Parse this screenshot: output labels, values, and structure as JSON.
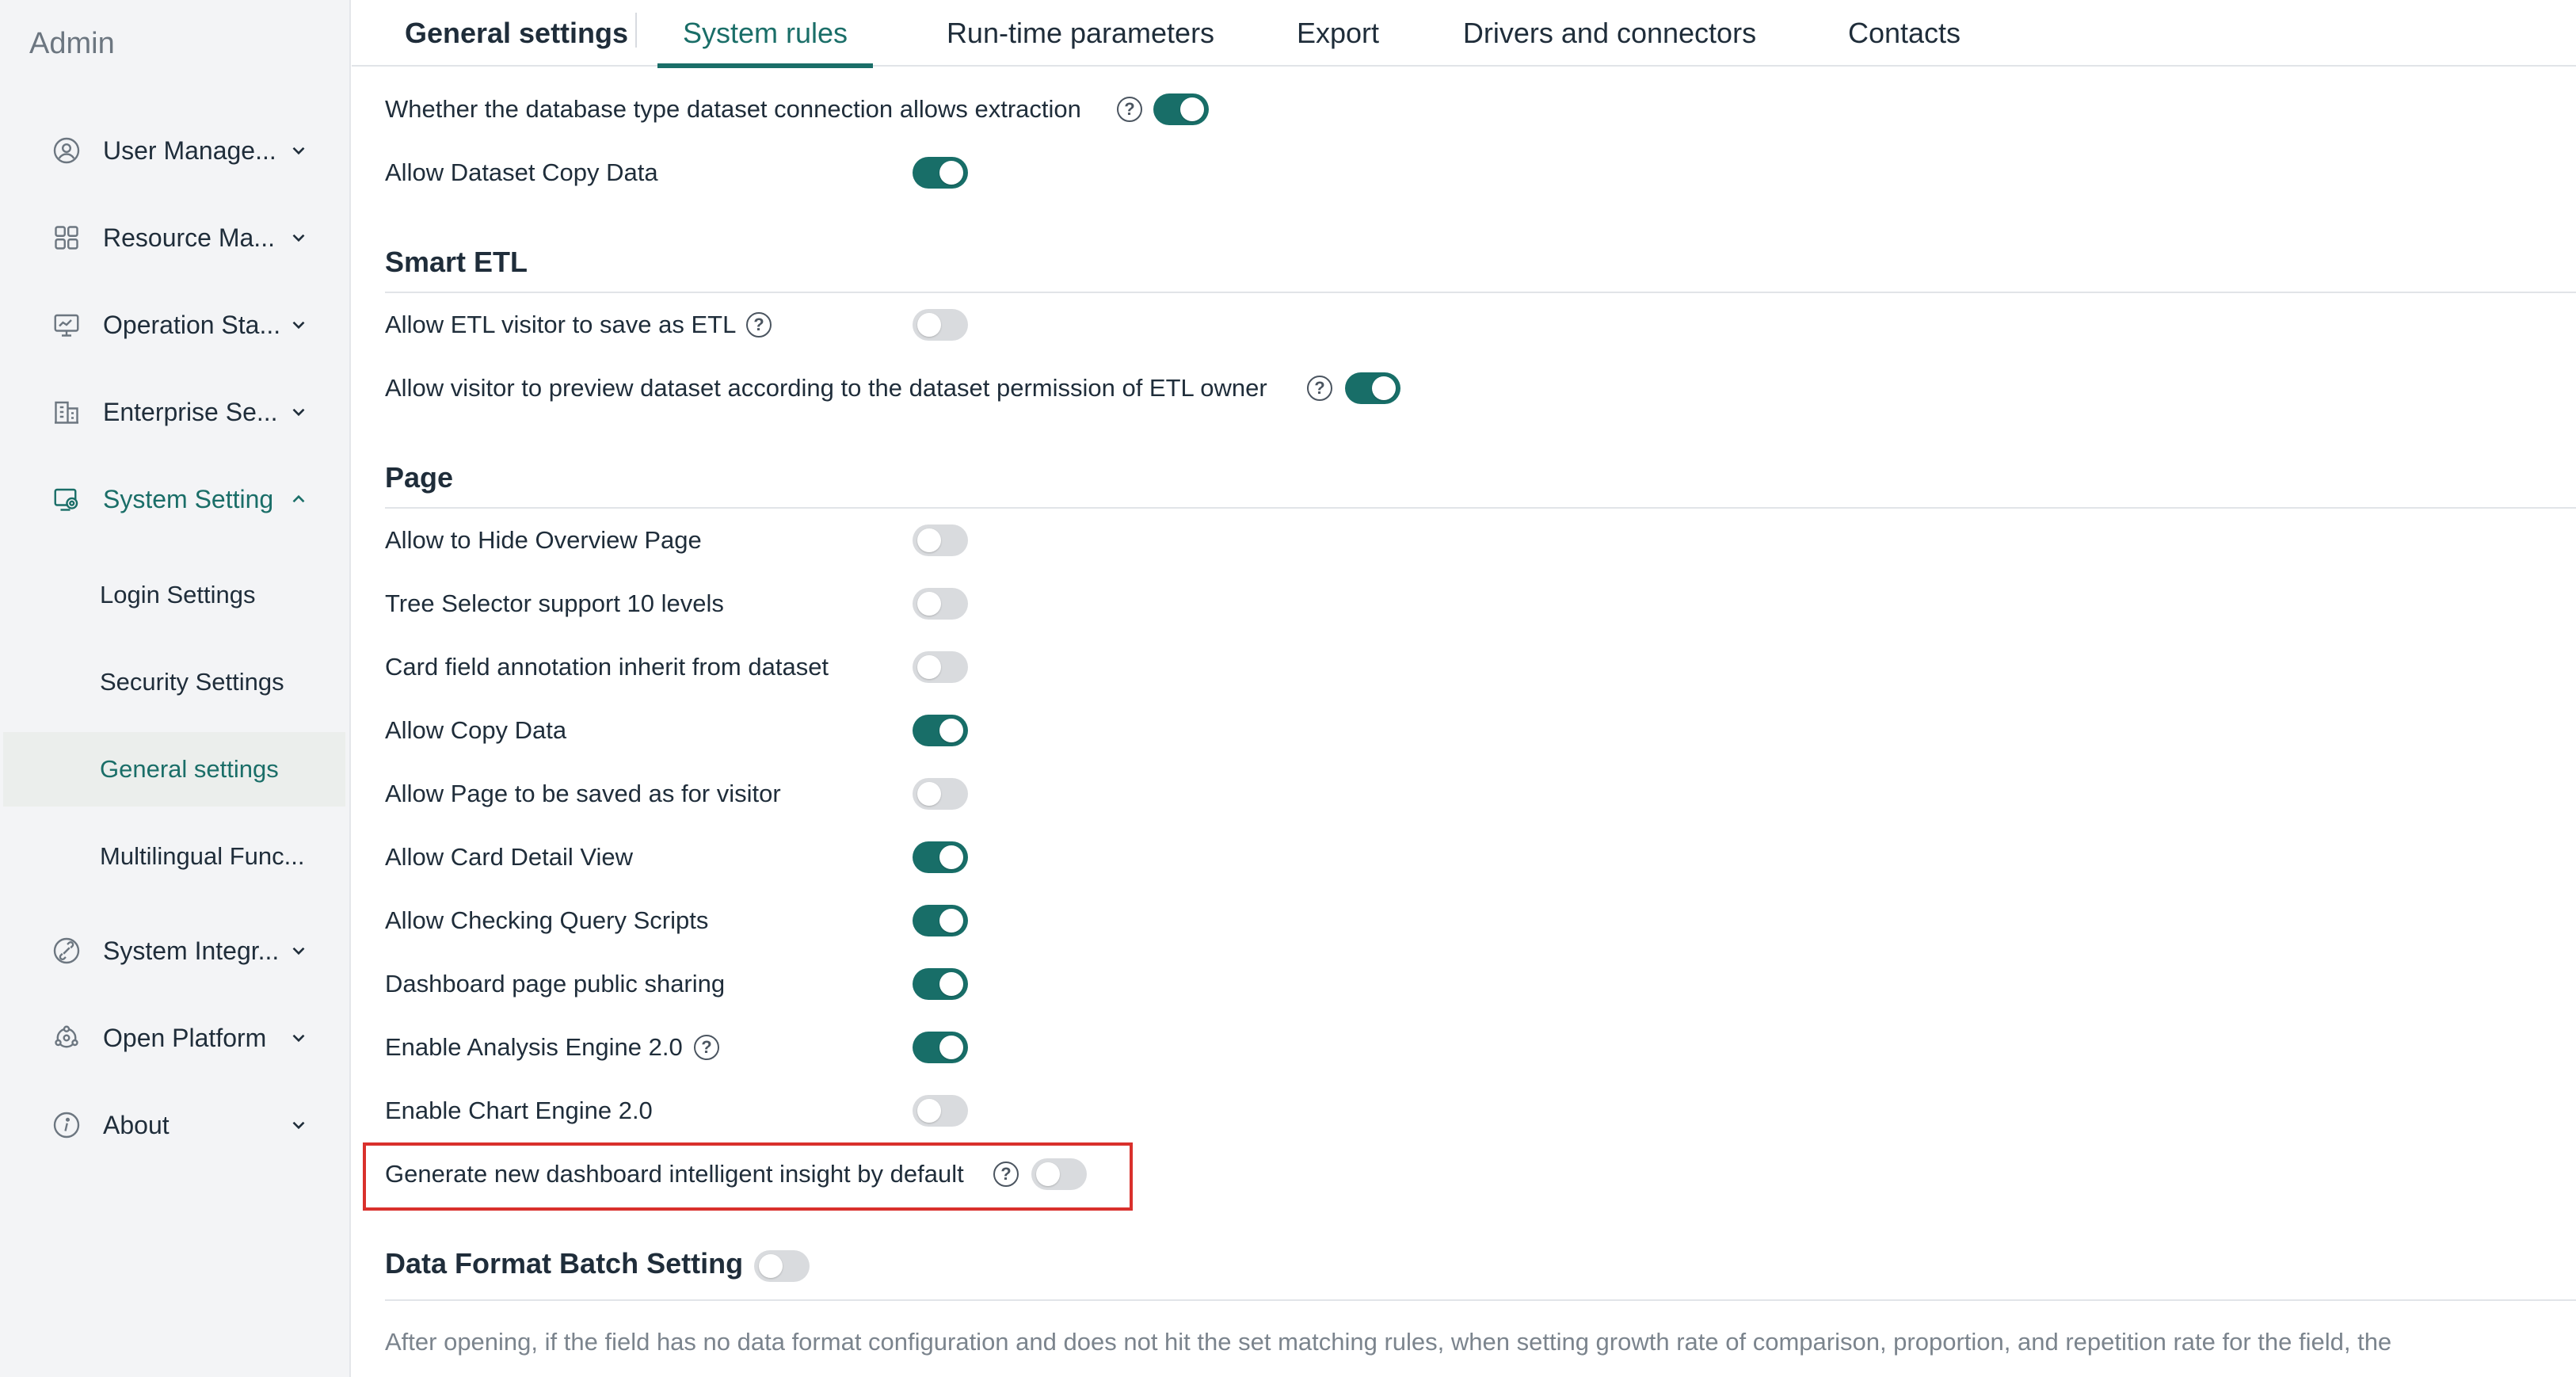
{
  "sidebar": {
    "brand": "Admin",
    "items": [
      {
        "label": "User Manage...",
        "icon": "user-icon"
      },
      {
        "label": "Resource Ma...",
        "icon": "grid-icon"
      },
      {
        "label": "Operation Sta...",
        "icon": "monitor-icon"
      },
      {
        "label": "Enterprise Se...",
        "icon": "building-icon"
      },
      {
        "label": "System Setting",
        "icon": "system-setting-icon",
        "expanded": true
      },
      {
        "label": "System Integr...",
        "icon": "integration-icon"
      },
      {
        "label": "Open Platform",
        "icon": "platform-icon"
      },
      {
        "label": "About",
        "icon": "info-icon"
      }
    ],
    "sub_items": [
      {
        "label": "Login Settings"
      },
      {
        "label": "Security Settings"
      },
      {
        "label": "General settings",
        "selected": true
      },
      {
        "label": "Multilingual Func..."
      }
    ]
  },
  "tabs": [
    {
      "label": "General settings"
    },
    {
      "label": "System rules",
      "active": true
    },
    {
      "label": "Run-time parameters"
    },
    {
      "label": "Export"
    },
    {
      "label": "Drivers and connectors"
    },
    {
      "label": "Contacts"
    }
  ],
  "dataset_rows": [
    {
      "label": "Whether the database type dataset connection allows extraction",
      "help": true,
      "on": true
    },
    {
      "label": "Allow Dataset Copy Data",
      "help": false,
      "on": true
    }
  ],
  "smart_etl": {
    "title": "Smart ETL",
    "rows": [
      {
        "label": "Allow ETL visitor to save as ETL",
        "help": true,
        "on": false
      },
      {
        "label": "Allow visitor to preview dataset according to the dataset permission of ETL owner",
        "help": true,
        "on": true
      }
    ]
  },
  "page": {
    "title": "Page",
    "rows": [
      {
        "label": "Allow to Hide Overview Page",
        "help": false,
        "on": false
      },
      {
        "label": "Tree Selector support 10 levels",
        "help": false,
        "on": false
      },
      {
        "label": "Card field annotation inherit from dataset",
        "help": false,
        "on": false
      },
      {
        "label": "Allow Copy Data",
        "help": false,
        "on": true
      },
      {
        "label": "Allow Page to be saved as for visitor",
        "help": false,
        "on": false
      },
      {
        "label": "Allow Card Detail View",
        "help": false,
        "on": true
      },
      {
        "label": "Allow Checking Query Scripts",
        "help": false,
        "on": true
      },
      {
        "label": "Dashboard page public sharing",
        "help": false,
        "on": true
      },
      {
        "label": "Enable Analysis Engine 2.0",
        "help": true,
        "on": true
      },
      {
        "label": "Enable Chart Engine 2.0",
        "help": false,
        "on": false
      },
      {
        "label": "Generate new dashboard intelligent insight by default",
        "help": true,
        "on": false
      }
    ]
  },
  "data_format": {
    "title": "Data Format Batch Setting",
    "on": false,
    "description": "After opening, if the field has no data format configuration and does not hit the set matching rules, when setting growth rate of comparison, proportion, and repetition rate for the field, the"
  },
  "colors": {
    "accent": "#1a6e68",
    "toggle_on": "#186e68",
    "toggle_off": "#d9dbde",
    "highlight": "#d9302c"
  }
}
